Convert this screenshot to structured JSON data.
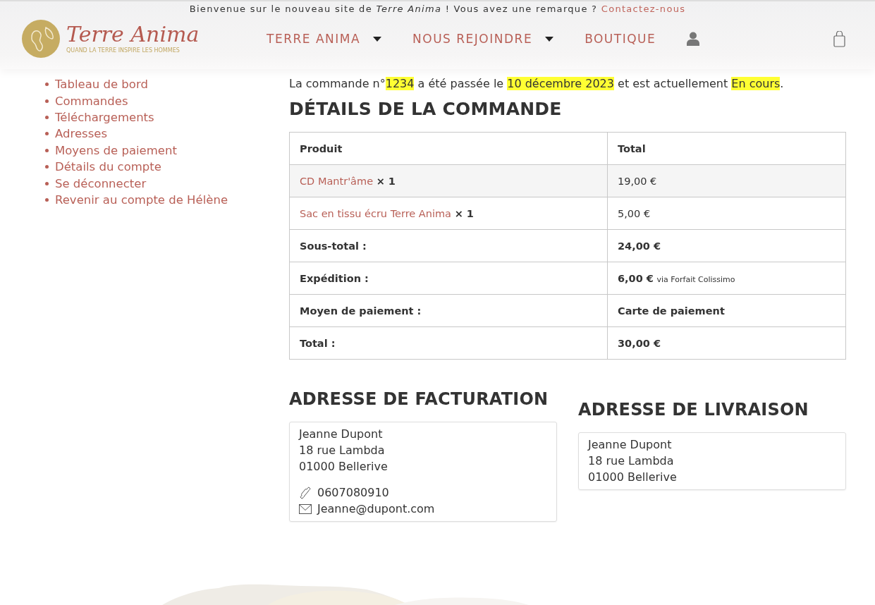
{
  "topbar": {
    "welcome": "Bienvenue sur le nouveau site de *Terre Anima* ! Vous avez une remarque ? ",
    "contact_link": "Contactez-nous"
  },
  "logo": {
    "name": "Terre Anima",
    "tagline": "QUAND LA TERRE INSPIRE LES HOMMES"
  },
  "nav": [
    {
      "label": "TERRE ANIMA",
      "dropdown": true
    },
    {
      "label": "NOUS REJOINDRE",
      "dropdown": true
    },
    {
      "label": "BOUTIQUE",
      "dropdown": false
    }
  ],
  "sidebar": {
    "items": [
      "Tableau de bord",
      "Commandes",
      "Téléchargements",
      "Adresses",
      "Moyens de paiement",
      "Détails du compte",
      "Se déconnecter",
      "Revenir au compte de Hélène"
    ]
  },
  "order_notice": [
    {
      "text": "La commande n°",
      "highlighted": false
    },
    {
      "text": "1234",
      "highlighted": true
    },
    {
      "text": " a été passée le ",
      "highlighted": false
    },
    {
      "text": "10 décembre 2023",
      "highlighted": true
    },
    {
      "text": " et est actuellement ",
      "highlighted": false
    },
    {
      "text": "En cours",
      "highlighted": true
    },
    {
      "text": ".",
      "highlighted": false
    }
  ],
  "order_details": {
    "title": "DÉTAILS DE LA COMMANDE",
    "columns": [
      "Produit",
      "Total"
    ],
    "items": [
      {
        "product": "CD Mantr'âme",
        "quantity": "× 1",
        "total": "19,00 €"
      },
      {
        "product": "Sac en tissu écru Terre Anima",
        "quantity": "× 1",
        "total": "5,00 €"
      }
    ],
    "summary": [
      {
        "label": "Sous-total :",
        "value": "24,00 €"
      },
      {
        "label": "Expédition :",
        "value": "6,00 €",
        "note": "via Forfait Colissimo"
      },
      {
        "label": "Moyen de paiement :",
        "value": "Carte de paiement"
      },
      {
        "label": "Total :",
        "value": "30,00 €"
      }
    ]
  },
  "billing": {
    "title": "ADRESSE DE FACTURATION",
    "lines": [
      "Jeanne Dupont",
      "18 rue Lambda",
      "01000 Bellerive"
    ],
    "phone": "0607080910",
    "email": "Jeanne@dupont.com"
  },
  "shipping": {
    "title": "ADRESSE DE LIVRAISON",
    "lines": [
      "Jeanne Dupont",
      "18 rue Lambda",
      "01000 Bellerive"
    ]
  }
}
